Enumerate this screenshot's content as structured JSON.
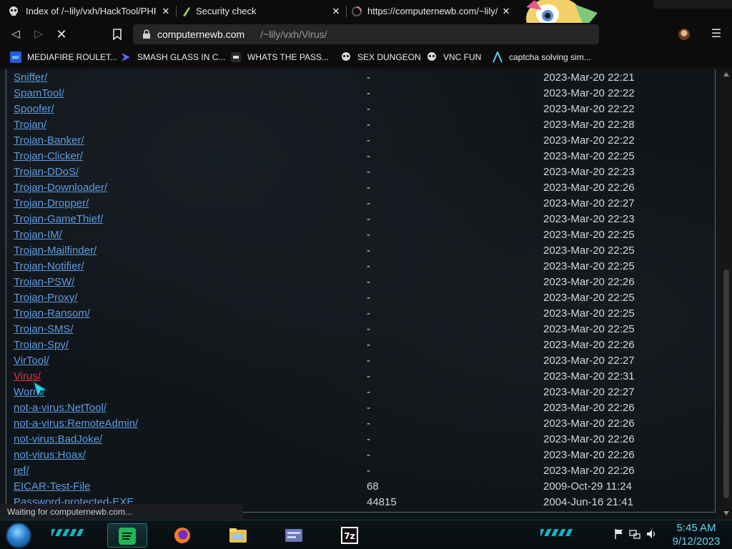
{
  "tabs": [
    {
      "title": "Index of /~lily/vxh/HackTool/PHP/",
      "close": "✕",
      "icon": "skull-icon"
    },
    {
      "title": "Security check",
      "close": "✕",
      "icon": "leaf-icon"
    },
    {
      "title": "https://computernewb.com/~lily/vxh/Virus/",
      "close": "✕",
      "icon": "loading-icon"
    }
  ],
  "toolbar": {
    "back": "◁",
    "forward": "▷",
    "stop": "✕",
    "bookmark": "bookmark-icon",
    "url_host": "computernewb.com",
    "url_path": "/~lily/vxh/Virus/",
    "menu": "☰"
  },
  "bookmarks": [
    {
      "label": "MEDIAFIRE ROULET...",
      "icon": "mediafire-icon"
    },
    {
      "label": "SMASH GLASS IN C...",
      "icon": "chevron-icon"
    },
    {
      "label": "WHATS THE PASS...",
      "icon": "dark-square-icon"
    },
    {
      "label": "SEX DUNGEON",
      "icon": "skull-icon"
    },
    {
      "label": "VNC FUN",
      "icon": "skull-icon"
    },
    {
      "label": "captcha solving sim...",
      "icon": "arch-icon"
    }
  ],
  "listing": [
    {
      "name": "Sniffer/",
      "size": "-",
      "date": "2023-Mar-20 22:21"
    },
    {
      "name": "SpamTool/",
      "size": "-",
      "date": "2023-Mar-20 22:22"
    },
    {
      "name": "Spoofer/",
      "size": "-",
      "date": "2023-Mar-20 22:22"
    },
    {
      "name": "Trojan/",
      "size": "-",
      "date": "2023-Mar-20 22:28"
    },
    {
      "name": "Trojan-Banker/",
      "size": "-",
      "date": "2023-Mar-20 22:22"
    },
    {
      "name": "Trojan-Clicker/",
      "size": "-",
      "date": "2023-Mar-20 22:25"
    },
    {
      "name": "Trojan-DDoS/",
      "size": "-",
      "date": "2023-Mar-20 22:23"
    },
    {
      "name": "Trojan-Downloader/",
      "size": "-",
      "date": "2023-Mar-20 22:26"
    },
    {
      "name": "Trojan-Dropper/",
      "size": "-",
      "date": "2023-Mar-20 22:27"
    },
    {
      "name": "Trojan-GameThief/",
      "size": "-",
      "date": "2023-Mar-20 22:23"
    },
    {
      "name": "Trojan-IM/",
      "size": "-",
      "date": "2023-Mar-20 22:25"
    },
    {
      "name": "Trojan-Mailfinder/",
      "size": "-",
      "date": "2023-Mar-20 22:25"
    },
    {
      "name": "Trojan-Notifier/",
      "size": "-",
      "date": "2023-Mar-20 22:25"
    },
    {
      "name": "Trojan-PSW/",
      "size": "-",
      "date": "2023-Mar-20 22:26"
    },
    {
      "name": "Trojan-Proxy/",
      "size": "-",
      "date": "2023-Mar-20 22:25"
    },
    {
      "name": "Trojan-Ransom/",
      "size": "-",
      "date": "2023-Mar-20 22:25"
    },
    {
      "name": "Trojan-SMS/",
      "size": "-",
      "date": "2023-Mar-20 22:25"
    },
    {
      "name": "Trojan-Spy/",
      "size": "-",
      "date": "2023-Mar-20 22:26"
    },
    {
      "name": "VirTool/",
      "size": "-",
      "date": "2023-Mar-20 22:27"
    },
    {
      "name": "Virus/",
      "size": "-",
      "date": "2023-Mar-20 22:31",
      "active": true
    },
    {
      "name": "Worm/",
      "size": "-",
      "date": "2023-Mar-20 22:27"
    },
    {
      "name": "not-a-virus:NetTool/",
      "size": "-",
      "date": "2023-Mar-20 22:26"
    },
    {
      "name": "not-a-virus:RemoteAdmin/",
      "size": "-",
      "date": "2023-Mar-20 22:26"
    },
    {
      "name": "not-virus:BadJoke/",
      "size": "-",
      "date": "2023-Mar-20 22:26"
    },
    {
      "name": "not-virus:Hoax/",
      "size": "-",
      "date": "2023-Mar-20 22:26"
    },
    {
      "name": "ref/",
      "size": "-",
      "date": "2023-Mar-20 22:26"
    },
    {
      "name": "EICAR-Test-File",
      "size": "68",
      "date": "2009-Oct-29 11:24"
    },
    {
      "name": "Password-protected-EXE",
      "size": "44815",
      "date": "2004-Jun-16 21:41"
    }
  ],
  "status_text": "Waiting for computernewb.com...",
  "taskbar": {
    "apps": [
      {
        "name": "spotify-icon",
        "active": true
      },
      {
        "name": "firefox-icon",
        "active": false
      },
      {
        "name": "file-explorer-icon",
        "active": false
      },
      {
        "name": "control-panel-icon",
        "active": false
      },
      {
        "name": "7zip-icon",
        "active": false
      }
    ],
    "tray": [
      "flag-icon",
      "network-icon",
      "volume-icon"
    ],
    "time": "5:45 AM",
    "date": "9/12/2023"
  },
  "colors": {
    "link": "#5d9ce0",
    "link_active": "#e9323a",
    "clock": "#62d5ef",
    "accent": "#19c4d6"
  }
}
